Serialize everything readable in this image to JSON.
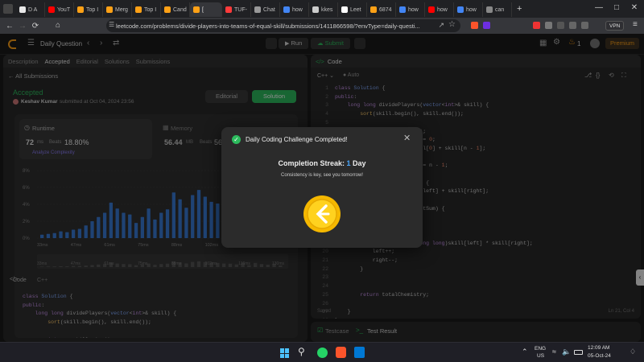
{
  "browser": {
    "tabs": [
      {
        "label": "D A",
        "color": "#e8e8e8"
      },
      {
        "label": "YouT",
        "color": "#ff0000"
      },
      {
        "label": "Top I",
        "color": "#ffa116"
      },
      {
        "label": "Merg",
        "color": "#ffa116"
      },
      {
        "label": "Top I",
        "color": "#ffa116"
      },
      {
        "label": "Cand",
        "color": "#ffa116"
      },
      {
        "label": "[",
        "color": "#ffa116"
      },
      {
        "label": "TUF-",
        "color": "#ff3b3b"
      },
      {
        "label": "Chat",
        "color": "#999999"
      },
      {
        "label": "how",
        "color": "#4285f4"
      },
      {
        "label": "kkes",
        "color": "#cccccc"
      },
      {
        "label": "Leet",
        "color": "#ffffff"
      },
      {
        "label": "6874",
        "color": "#ffa116"
      },
      {
        "label": "how",
        "color": "#4285f4"
      },
      {
        "label": "how",
        "color": "#ff0000"
      },
      {
        "label": "how",
        "color": "#4285f4"
      },
      {
        "label": "can",
        "color": "#888888"
      }
    ],
    "active_tab_index": 6,
    "new_tab": "+",
    "url": "leetcode.com/problems/divide-players-into-teams-of-equal-skill/submissions/1411866598/?envType=daily-questi...",
    "vpn_label": "VPN"
  },
  "nav": {
    "daily_question": "Daily Question",
    "run": "Run",
    "submit": "Submit",
    "streak": "1",
    "premium": "Premium"
  },
  "left": {
    "tabs": [
      "Description",
      "Accepted",
      "Editorial",
      "Solutions",
      "Submissions"
    ],
    "all_submissions": "All Submissions",
    "status": "Accepted",
    "author": "Keshav Kumar",
    "submitted": "submitted at Oct 04, 2024 23:56",
    "editorial_btn": "Editorial",
    "solution_btn": "Solution",
    "runtime_label": "Runtime",
    "runtime_value": "72",
    "runtime_unit": "ms",
    "beats_label": "Beats",
    "beats_value": "18.80%",
    "analyze": "Analyze Complexity",
    "memory_label": "Memory",
    "memory_value": "56.44",
    "memory_unit": "MB",
    "memory_beats_label": "Beats",
    "memory_beats_value": "56",
    "code_label": "Code",
    "lang": "C++"
  },
  "chart_data": {
    "type": "bar",
    "yticks": [
      "8%",
      "6%",
      "4%",
      "2%",
      "0%"
    ],
    "ylim": [
      0,
      8
    ],
    "xticks": [
      "33ms",
      "47ms",
      "61ms",
      "75ms",
      "88ms",
      "102ms",
      "116ms",
      "130ms"
    ],
    "values": [
      0.4,
      0.5,
      0.6,
      0.8,
      0.7,
      1.0,
      1.1,
      1.5,
      2.0,
      2.5,
      3.0,
      4.2,
      3.5,
      3.0,
      2.8,
      1.8,
      2.5,
      3.5,
      2.2,
      3.0,
      3.4,
      5.4,
      4.6,
      3.6,
      5.1,
      5.7,
      4.9,
      4.3,
      4.1,
      3.5,
      3.4,
      2.6,
      4.4,
      1.8,
      4.1,
      3.0,
      2.3,
      3.4,
      1.6
    ],
    "overview_labels": [
      "33ms",
      "47ms",
      "61ms",
      "75ms",
      "88ms",
      "102ms",
      "116ms",
      "130ms"
    ]
  },
  "left_code": [
    "class Solution {",
    "public:",
    "    long long dividePlayers(vector<int>& skill) {",
    "        sort(skill.begin(), skill.end());",
    "",
    "        int n = skill.size();"
  ],
  "right": {
    "code_tab": "Code",
    "lang": "C++",
    "auto": "Auto",
    "saved": "Saved",
    "cursor": "Ln 21, Col 4",
    "testcase": "Testcase",
    "test_result": "Test Result",
    "line_numbers": [
      "1",
      "2",
      "3",
      "4",
      "5",
      "6",
      "7",
      "8",
      "9",
      "10",
      "11",
      "12",
      "13",
      "14",
      "15",
      "16",
      "17",
      "18",
      "19",
      "20",
      "21",
      "22",
      "23",
      "24",
      "25",
      "26",
      "27",
      "28"
    ],
    "code_lines": [
      "class Solution {",
      "public:",
      "    long long dividePlayers(vector<int>& skill) {",
      "        sort(skill.begin(), skill.end());",
      "",
      "        int n = skill.size();",
      "        long long chemistry = 0;",
      "        int targetSum = skill[0] + skill[n - 1];",
      "",
      "        int left = 0, right = n - 1;",
      "",
      "        while (left < right) {",
      "            int sum = skill[left] + skill[right];",
      "",
      "            if (sum != targetSum) {",
      "                return -1;",
      "            }",
      "",
      "            chemistry += (long long)skill[left] * skill[right];",
      "            left++;",
      "            right--;",
      "        }",
      "",
      "",
      "        return totalChemistry;",
      "",
      "    }",
      "};"
    ]
  },
  "modal": {
    "title": "Daily Coding Challenge Completed!",
    "streak_label": "Completion Streak:",
    "streak_value": "1",
    "streak_unit": "Day",
    "message": "Consistency is key, see you tomorrow!"
  },
  "taskbar": {
    "lang_top": "ENG",
    "lang_bottom": "US",
    "time": "12:09 AM",
    "date": "05-Oct-24"
  }
}
